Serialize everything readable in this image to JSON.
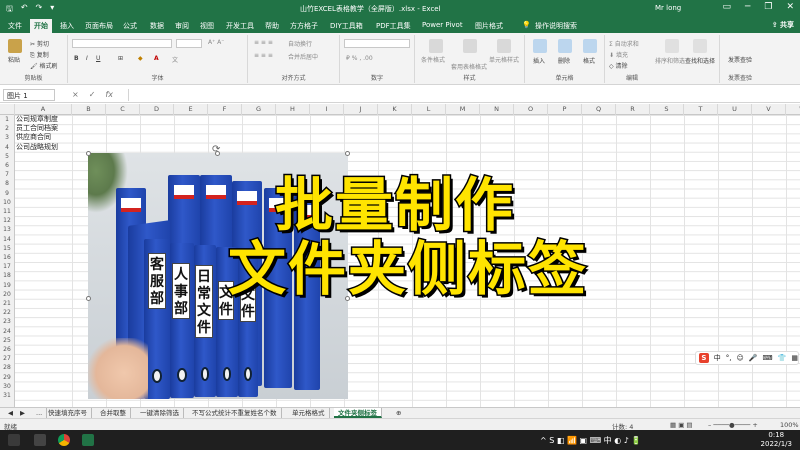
{
  "titlebar": {
    "title": "山竹EXCEL表格教学（全屏版）.xlsx  -  Excel",
    "user": "Mr long",
    "icons": [
      "save-icon",
      "undo-icon",
      "redo-icon",
      "customize-icon"
    ]
  },
  "ribbon_tabs": [
    "文件",
    "开始",
    "插入",
    "页面布局",
    "公式",
    "数据",
    "审阅",
    "视图",
    "开发工具",
    "帮助",
    "方方格子",
    "DIY工具箱",
    "PDF工具集",
    "Power Pivot",
    "图片格式",
    "操作说明搜索"
  ],
  "active_tab": "开始",
  "share_label": "共享",
  "ribbon": {
    "clipboard": {
      "paste": "粘贴",
      "cut": "剪切",
      "copy": "复制",
      "format_painter": "格式刷",
      "label": "剪贴板"
    },
    "font": {
      "label": "字体"
    },
    "alignment": {
      "wrap": "自动换行",
      "merge": "合并后居中",
      "label": "对齐方式"
    },
    "number": {
      "label": "数字"
    },
    "styles": {
      "cond": "条件格式",
      "table": "套用表格格式",
      "cell": "单元格样式",
      "label": "样式"
    },
    "cells": {
      "insert": "插入",
      "delete": "删除",
      "format": "格式",
      "label": "单元格"
    },
    "editing": {
      "autosum": "自动求和",
      "fill": "填充",
      "clear": "清除",
      "sort": "排序和筛选",
      "find": "查找和选择",
      "label": "编辑"
    },
    "invoice": {
      "check": "发票查验",
      "label": "发票查验"
    }
  },
  "formula_bar": {
    "name_box": "图片 1",
    "fx": "fx",
    "cancel": "×",
    "enter": "✓"
  },
  "columns": [
    "A",
    "B",
    "C",
    "D",
    "E",
    "F",
    "G",
    "H",
    "I",
    "J",
    "K",
    "L",
    "M",
    "N",
    "O",
    "P",
    "Q",
    "R",
    "S",
    "T",
    "U",
    "V",
    "W"
  ],
  "rows": [
    "1",
    "2",
    "3",
    "4",
    "5",
    "6",
    "7",
    "8",
    "9",
    "10",
    "11",
    "12",
    "13",
    "14",
    "15",
    "16",
    "17",
    "18",
    "19",
    "20",
    "21",
    "22",
    "23",
    "24",
    "25",
    "26",
    "27",
    "28",
    "29",
    "30",
    "31"
  ],
  "cells": {
    "a1": "公司规章制度",
    "a2": "员工合同档案",
    "a3": "供应商合同",
    "a4": "公司战略规划"
  },
  "overlay": {
    "line1": "批量制作",
    "line2": "文件夹侧标签"
  },
  "photo_labels": [
    {
      "chars": [
        "客",
        "服",
        "部"
      ]
    },
    {
      "chars": [
        "人",
        "事",
        "部"
      ]
    },
    {
      "chars": [
        "日",
        "常",
        "文",
        "件"
      ]
    },
    {
      "chars": [
        "文",
        "件"
      ]
    },
    {
      "chars": [
        "文",
        "件"
      ]
    }
  ],
  "sheet_tabs": [
    "...",
    "快速填充序号",
    "合并取整",
    "一键清除筛选",
    "不写公式统计不重复姓名个数",
    "单元格格式",
    "文件夹侧标签"
  ],
  "active_sheet": "文件夹侧标签",
  "status": {
    "mode": "就绪",
    "count": "计数: 4",
    "zoom": "100%"
  },
  "ime_bar": {
    "lang": "中"
  },
  "taskbar": {
    "time": "0:18",
    "date": "2022/1/3"
  }
}
